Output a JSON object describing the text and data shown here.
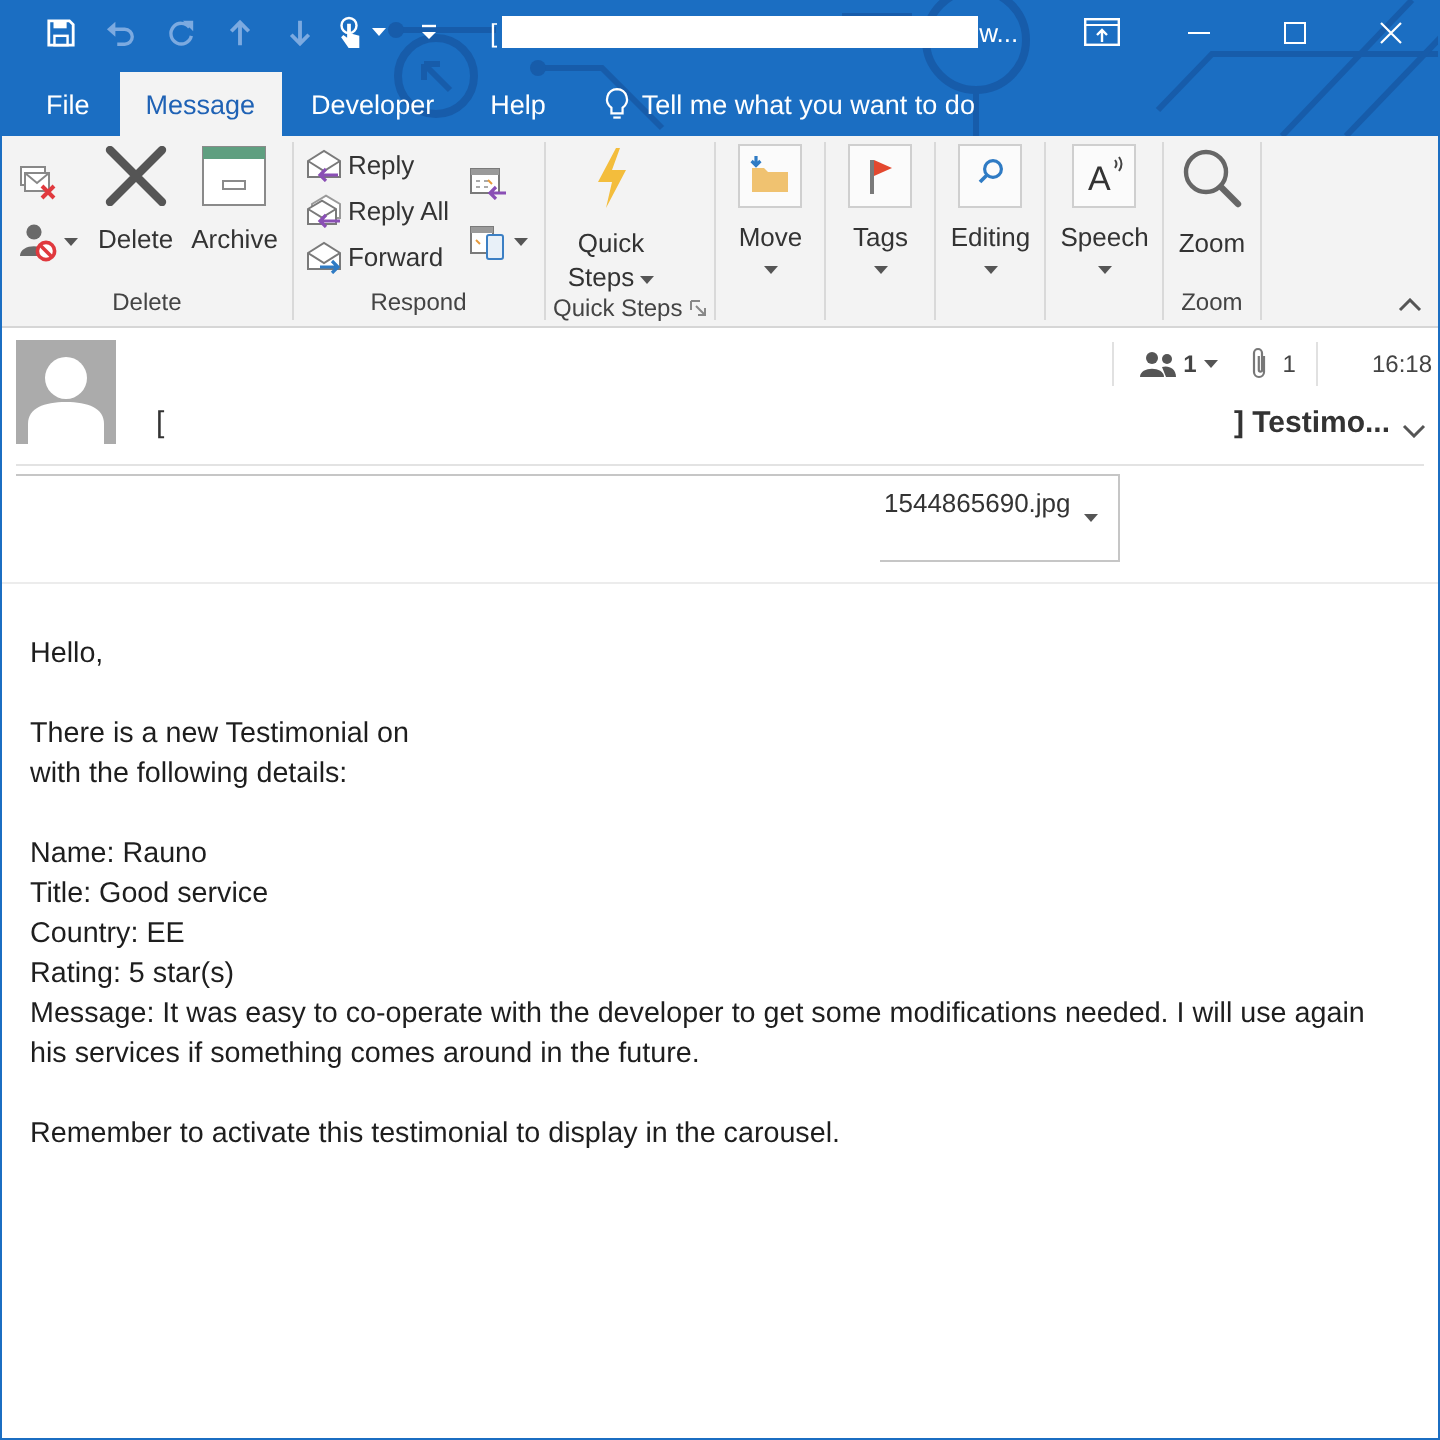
{
  "title_bar": {
    "quick_access": [
      {
        "kind": "save",
        "disabled": false
      },
      {
        "kind": "undo",
        "disabled": true
      },
      {
        "kind": "redo",
        "disabled": true
      },
      {
        "kind": "up",
        "disabled": true
      },
      {
        "kind": "down",
        "disabled": true
      },
      {
        "kind": "touch",
        "disabled": false,
        "caret": true
      },
      {
        "kind": "customize",
        "disabled": false
      }
    ],
    "title_parts": [
      "[",
      "w..."
    ]
  },
  "tabs": [
    {
      "label": "File",
      "selected": false
    },
    {
      "label": "Message",
      "selected": true
    },
    {
      "label": "Developer",
      "selected": false
    },
    {
      "label": "Help",
      "selected": false
    }
  ],
  "tell_me": {
    "placeholder": "Tell me what you want to do"
  },
  "ribbon": {
    "groups": [
      {
        "label": "Delete",
        "launcher": false,
        "columns": [
          {
            "kind": "stack",
            "items": [
              {
                "caret": false
              },
              {
                "caret": true
              }
            ]
          },
          {
            "kind": "large",
            "label": "Delete",
            "caret": false
          },
          {
            "kind": "large",
            "label": "Archive",
            "caret": false
          }
        ]
      },
      {
        "label": "Respond",
        "launcher": false,
        "columns": [
          {
            "kind": "stack",
            "items": [
              {
                "label": "Reply",
                "caret": false
              },
              {
                "label": "Reply All",
                "caret": false
              },
              {
                "label": "Forward",
                "caret": false
              }
            ]
          },
          {
            "kind": "stack",
            "items": [
              {
                "caret": false
              },
              {
                "caret": true
              }
            ]
          }
        ]
      },
      {
        "label": "Quick Steps",
        "launcher": true,
        "columns": [
          {
            "kind": "large",
            "label": "Quick Steps",
            "caret": true
          }
        ]
      },
      {
        "columns": [
          {
            "kind": "boxed",
            "label": "Move",
            "caret": true
          }
        ]
      },
      {
        "columns": [
          {
            "kind": "boxed",
            "label": "Tags",
            "caret": true
          }
        ]
      },
      {
        "columns": [
          {
            "kind": "boxed",
            "label": "Editing",
            "caret": true
          }
        ]
      },
      {
        "columns": [
          {
            "kind": "boxed",
            "label": "Speech",
            "glyph": "A",
            "caret": true
          }
        ]
      },
      {
        "label": "Zoom",
        "launcher": false,
        "columns": [
          {
            "kind": "large",
            "label": "Zoom",
            "caret": false
          }
        ]
      }
    ]
  },
  "message": {
    "recipients": "1",
    "attachments_count": "1",
    "time": "16:18",
    "subject_parts": [
      "[",
      "] Testimo..."
    ],
    "attachment": {
      "name": "1544865690.jpg"
    }
  },
  "body": {
    "paragraphs": [
      [
        "Hello,"
      ],
      [
        "There is a new Testimonial on",
        "with the following details:"
      ],
      [
        "Name: Rauno",
        "Title: Good service",
        "Country: EE",
        "Rating: 5 star(s)",
        "Message: It was easy to co-operate with the developer to get some modifications needed. I will use again his services if something comes around in the future."
      ],
      [
        "Remember to activate this testimonial to display in the carousel."
      ]
    ]
  }
}
